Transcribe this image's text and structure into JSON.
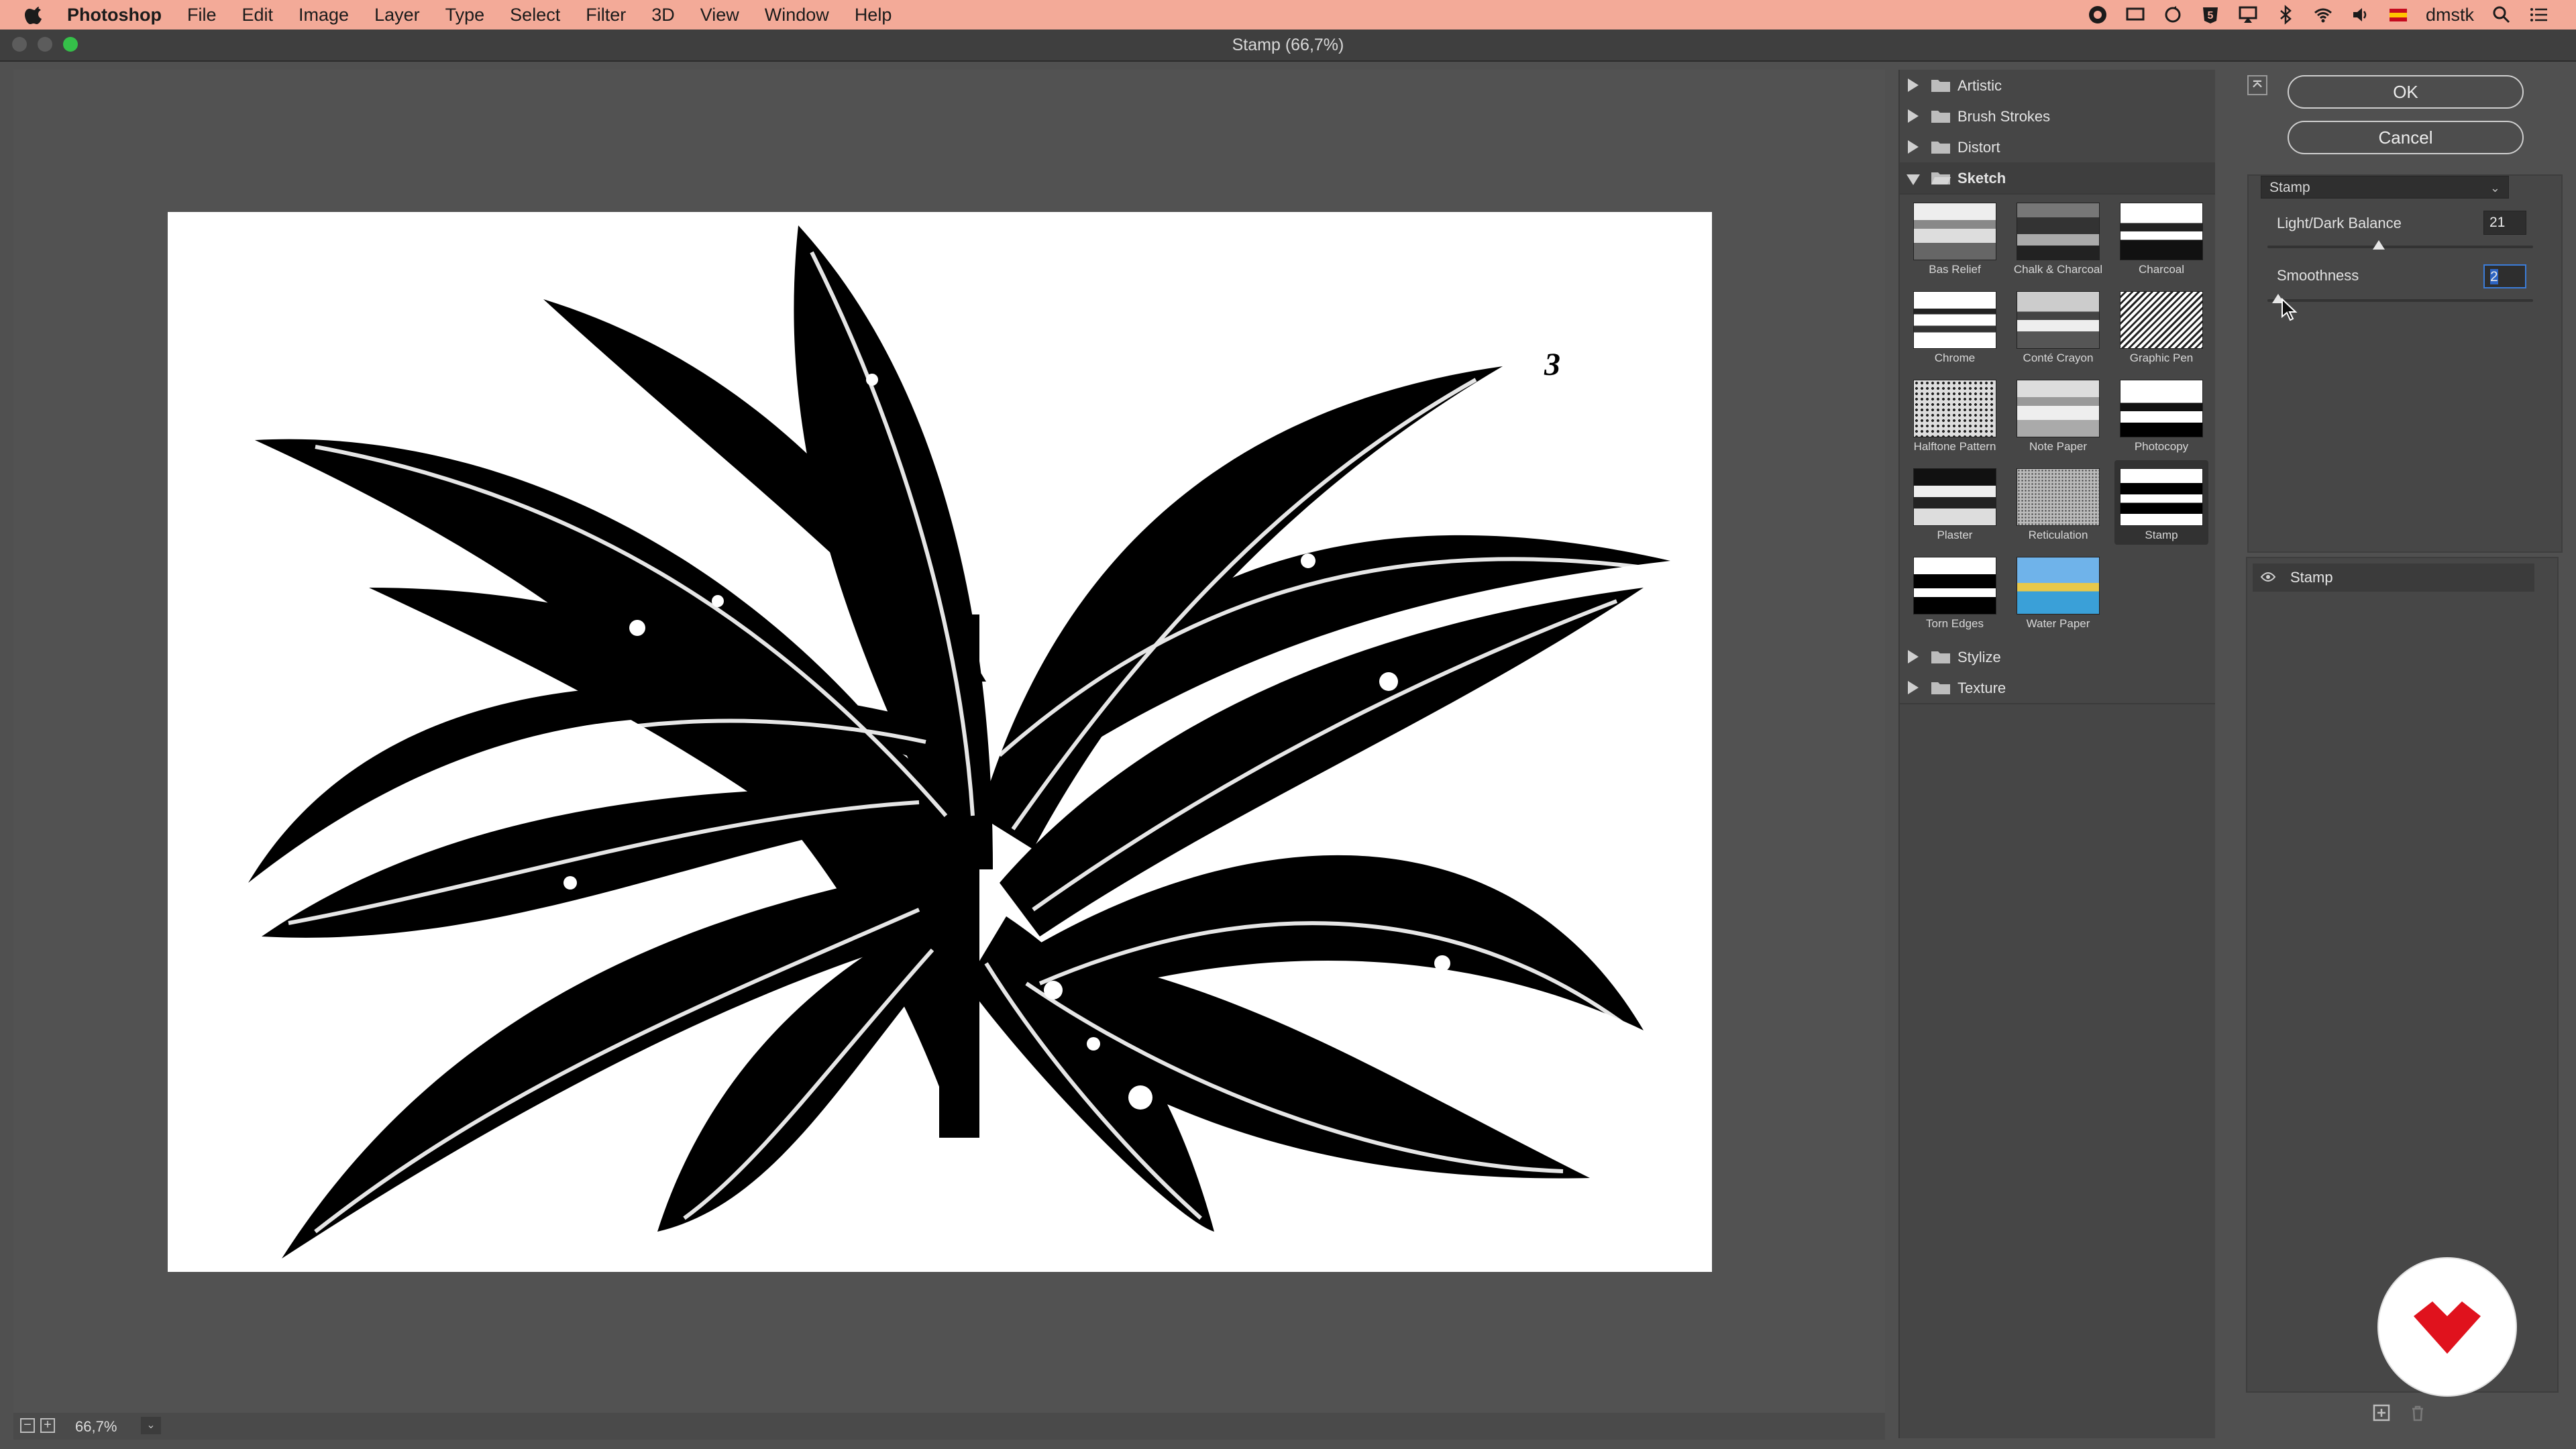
{
  "menubar": {
    "app_name": "Photoshop",
    "menus": [
      "File",
      "Edit",
      "Image",
      "Layer",
      "Type",
      "Select",
      "Filter",
      "3D",
      "View",
      "Window",
      "Help"
    ],
    "user": "dmstk",
    "status_icons": [
      "creative-cloud-icon",
      "screen-icon",
      "sync-icon",
      "five-icon",
      "airplay-icon",
      "bluetooth-icon",
      "wifi-icon",
      "volume-icon",
      "flag-icon"
    ]
  },
  "window": {
    "title": "Stamp (66,7%)"
  },
  "preview": {
    "zoom_level": "66,7%",
    "plate_number": "3"
  },
  "gallery": {
    "categories_top": [
      {
        "label": "Artistic",
        "open": false
      },
      {
        "label": "Brush Strokes",
        "open": false
      },
      {
        "label": "Distort",
        "open": false
      },
      {
        "label": "Sketch",
        "open": true
      }
    ],
    "sketch_filters": [
      "Bas Relief",
      "Chalk & Charcoal",
      "Charcoal",
      "Chrome",
      "Conté Crayon",
      "Graphic Pen",
      "Halftone Pattern",
      "Note Paper",
      "Photocopy",
      "Plaster",
      "Reticulation",
      "Stamp",
      "Torn Edges",
      "Water Paper"
    ],
    "selected_filter": "Stamp",
    "categories_bottom": [
      {
        "label": "Stylize",
        "open": false
      },
      {
        "label": "Texture",
        "open": false
      }
    ]
  },
  "controls": {
    "ok_label": "OK",
    "cancel_label": "Cancel",
    "filter_dropdown": "Stamp",
    "params": [
      {
        "label": "Light/Dark Balance",
        "value": "21",
        "slider_fraction": 0.42
      },
      {
        "label": "Smoothness",
        "value": "2",
        "slider_fraction": 0.04
      }
    ]
  },
  "layers": {
    "effect_layer": "Stamp"
  },
  "colors": {
    "menubar_bg": "#f3aa98",
    "panel_bg": "#464646",
    "accent": "#3b7cd8",
    "logo_red": "#e0121d"
  }
}
